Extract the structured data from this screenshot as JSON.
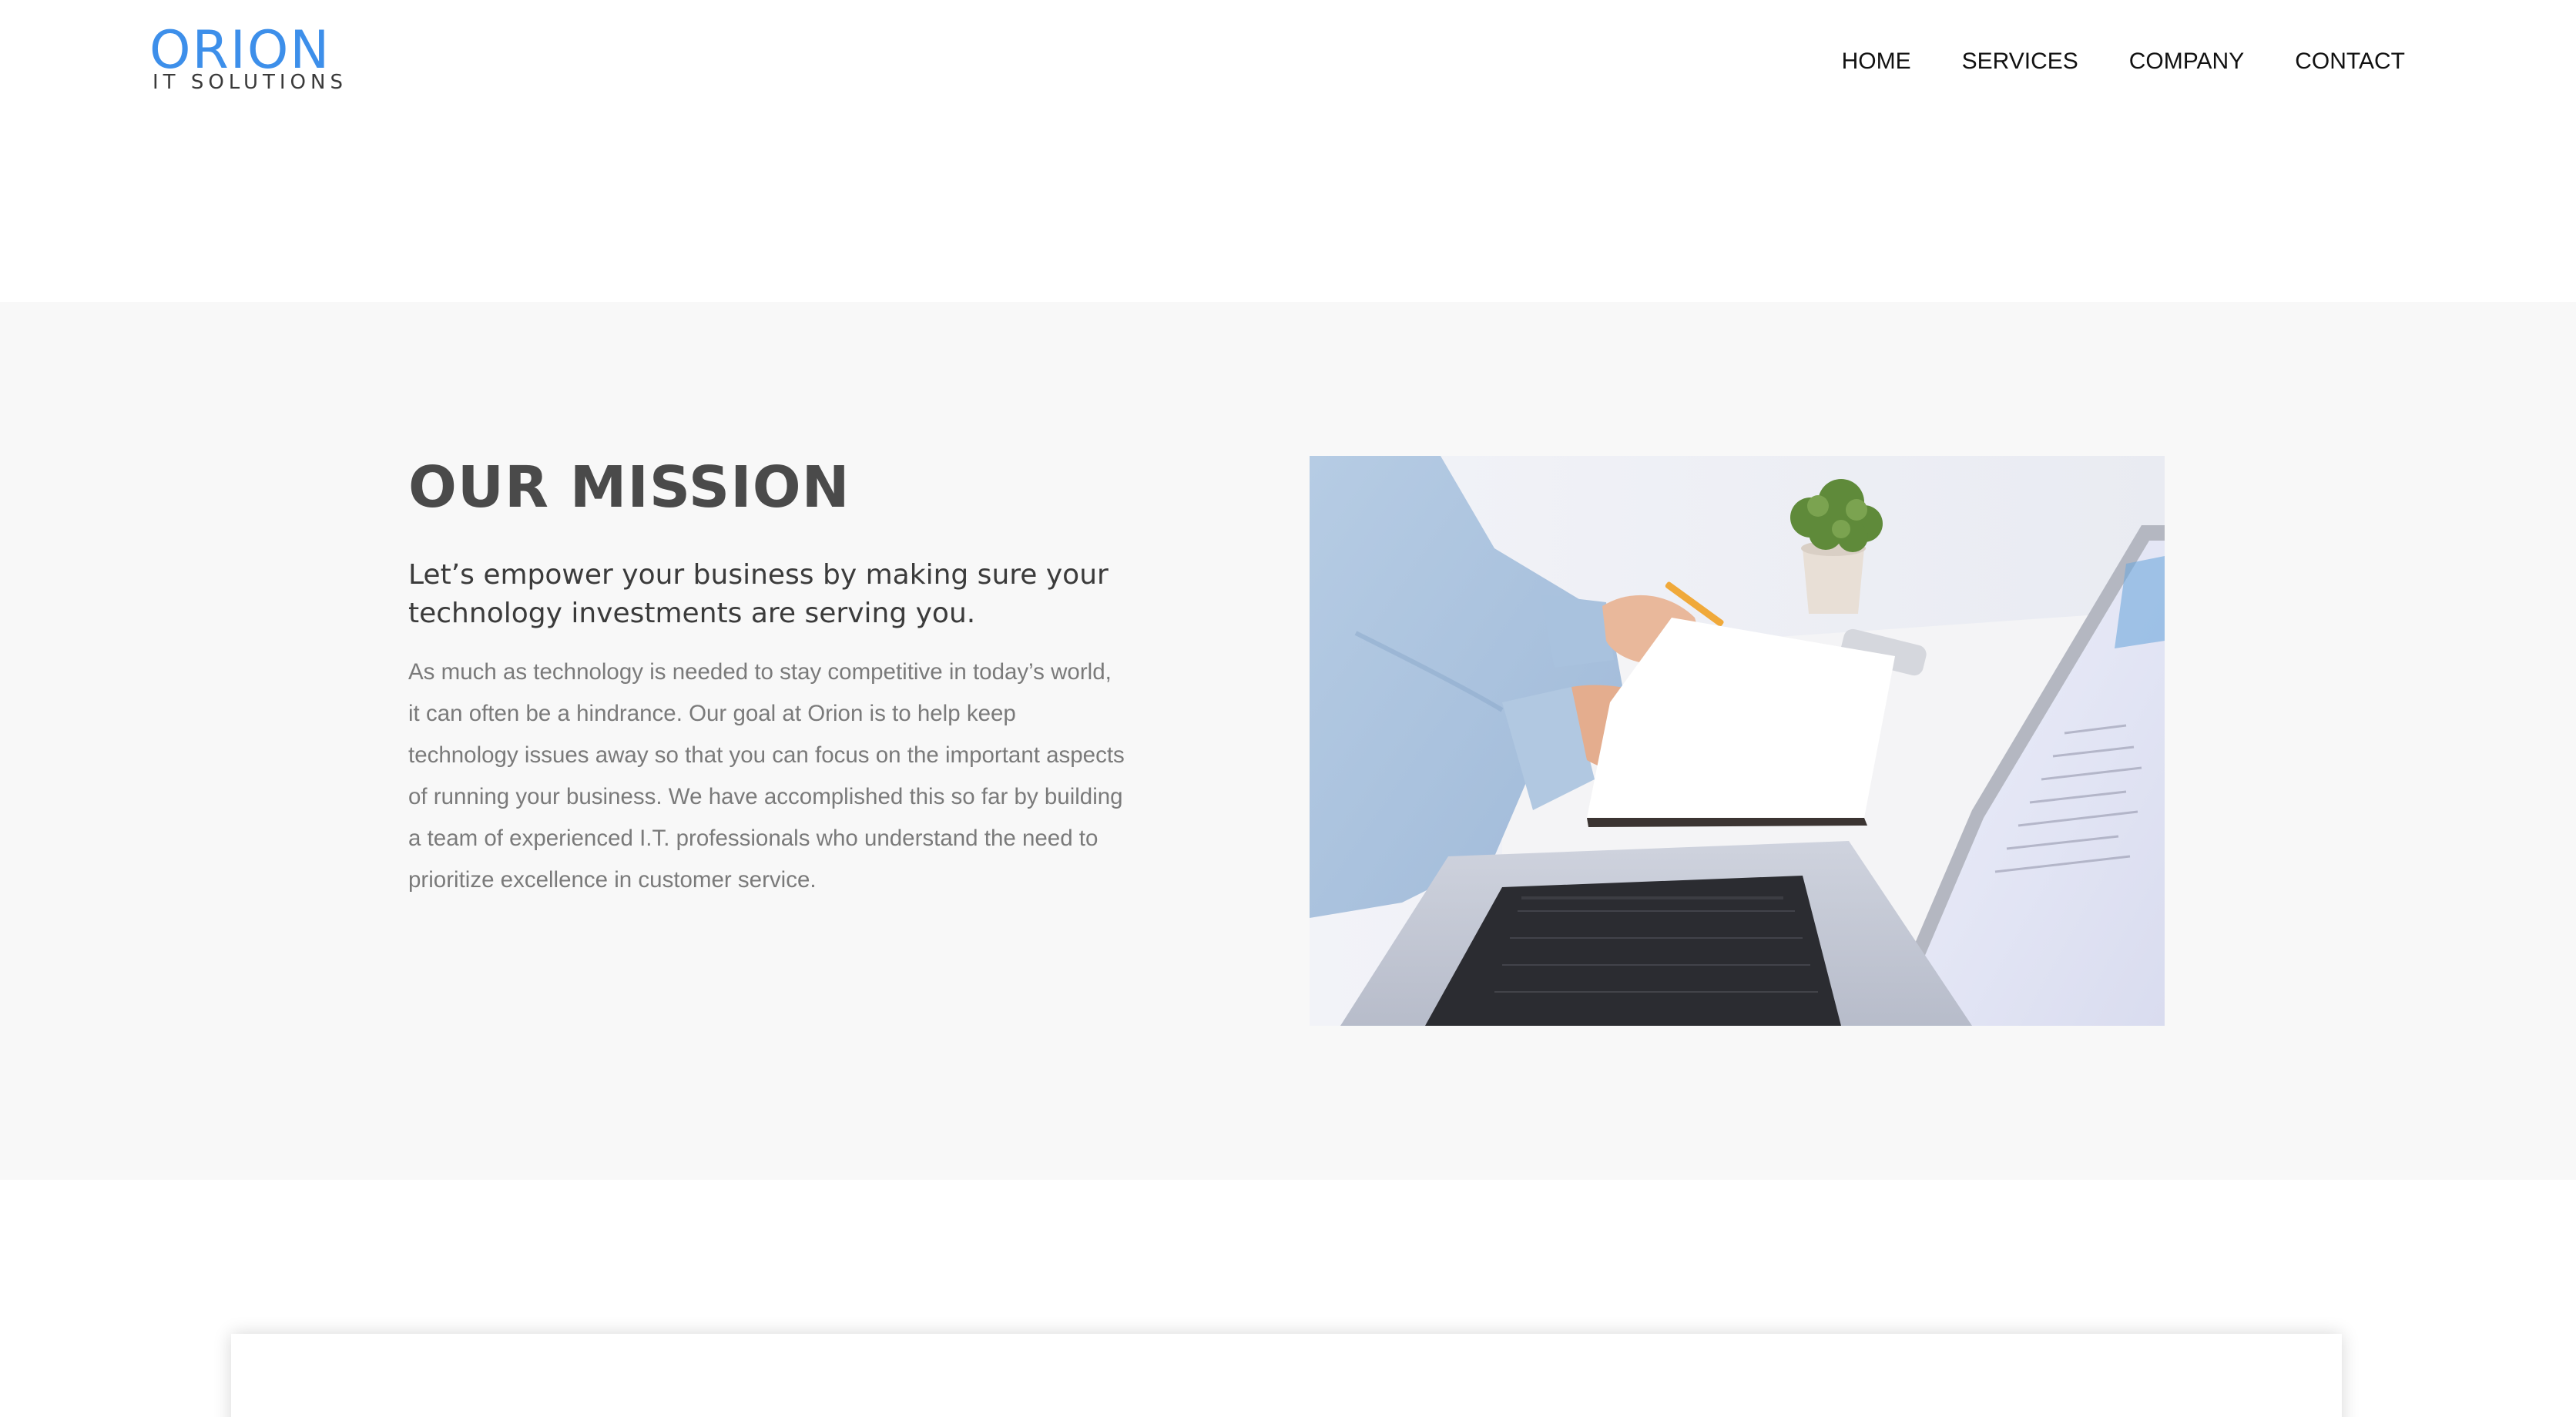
{
  "brand": {
    "logo_word": "ORION",
    "logo_tagline": "IT SOLUTIONS",
    "logo_color": "#3d8fea"
  },
  "nav": {
    "items": [
      {
        "label": "HOME"
      },
      {
        "label": "SERVICES"
      },
      {
        "label": "COMPANY"
      },
      {
        "label": "CONTACT"
      }
    ]
  },
  "mission": {
    "title": "OUR MISSION",
    "lead": "Let’s empower your business by making sure your technology investments are serving you.",
    "body": "As much as technology is needed to stay competitive in today’s world, it can often be a hindrance. Our goal at Orion is to help keep technology issues away so that you can focus on the important aspects of running your business. We have accomplished this so far by building a team of experienced I.T. professionals who understand the need to prioritize excellence in customer service.",
    "image_subject": "person writing in a notebook next to a laptop"
  },
  "colors": {
    "section_background": "#f8f8f8",
    "title_text": "#4a4a4a",
    "body_text": "#7a7a7a"
  }
}
